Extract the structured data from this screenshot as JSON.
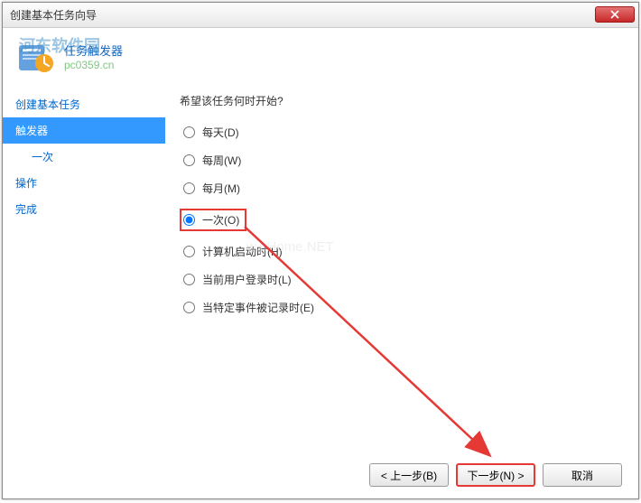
{
  "window": {
    "title": "创建基本任务向导"
  },
  "header": {
    "title": "任务触发器",
    "watermark_brand": "河东软件园",
    "watermark_url": "pc0359.cn"
  },
  "sidebar": {
    "items": [
      {
        "label": "创建基本任务",
        "active": false,
        "sub": false
      },
      {
        "label": "触发器",
        "active": true,
        "sub": false
      },
      {
        "label": "一次",
        "active": false,
        "sub": true
      },
      {
        "label": "操作",
        "active": false,
        "sub": false
      },
      {
        "label": "完成",
        "active": false,
        "sub": false
      }
    ]
  },
  "main": {
    "question": "希望该任务何时开始?",
    "options": [
      {
        "label": "每天(D)",
        "value": "daily",
        "checked": false
      },
      {
        "label": "每周(W)",
        "value": "weekly",
        "checked": false
      },
      {
        "label": "每月(M)",
        "value": "monthly",
        "checked": false
      },
      {
        "label": "一次(O)",
        "value": "once",
        "checked": true
      },
      {
        "label": "计算机启动时(H)",
        "value": "startup",
        "checked": false
      },
      {
        "label": "当前用户登录时(L)",
        "value": "logon",
        "checked": false
      },
      {
        "label": "当特定事件被记录时(E)",
        "value": "event",
        "checked": false
      }
    ],
    "watermark": "w.pHome.NET"
  },
  "footer": {
    "back_label": "< 上一步(B)",
    "next_label": "下一步(N) >",
    "cancel_label": "取消"
  },
  "colors": {
    "highlight": "#e53935",
    "accent": "#3399ff",
    "link": "#0066cc"
  }
}
